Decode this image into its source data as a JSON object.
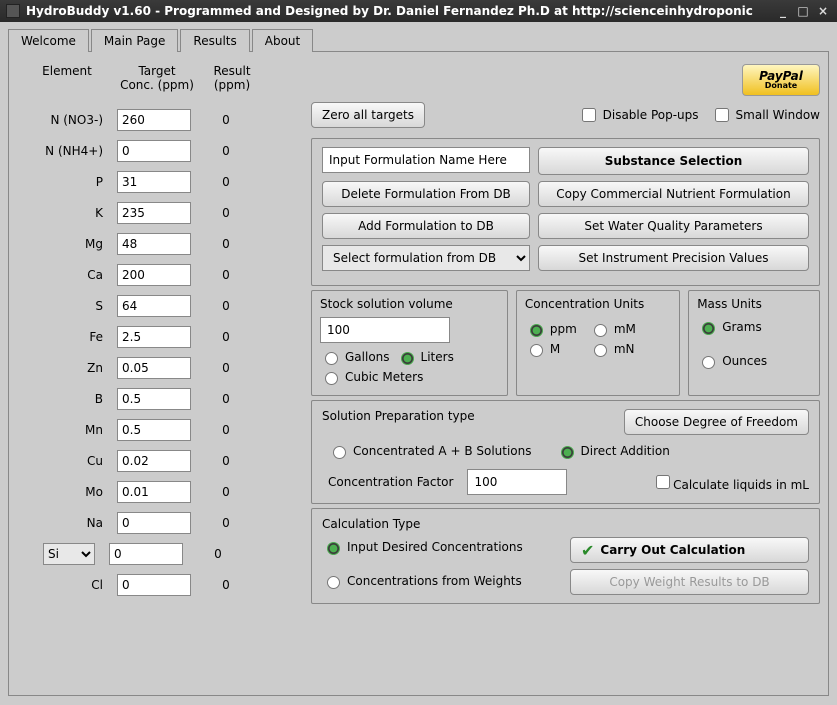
{
  "window": {
    "title": "HydroBuddy v1.60 - Programmed and Designed by Dr. Daniel Fernandez Ph.D at http://scienceinhydroponic"
  },
  "tabs": [
    "Welcome",
    "Main Page",
    "Results",
    "About"
  ],
  "activeTab": 1,
  "headers": {
    "element": "Element",
    "target1": "Target",
    "target2": "Conc. (ppm)",
    "result1": "Result",
    "result2": "(ppm)"
  },
  "elements": [
    {
      "label": "N (NO3-)",
      "target": "260",
      "result": "0"
    },
    {
      "label": "N (NH4+)",
      "target": "0",
      "result": "0"
    },
    {
      "label": "P",
      "target": "31",
      "result": "0"
    },
    {
      "label": "K",
      "target": "235",
      "result": "0"
    },
    {
      "label": "Mg",
      "target": "48",
      "result": "0"
    },
    {
      "label": "Ca",
      "target": "200",
      "result": "0"
    },
    {
      "label": "S",
      "target": "64",
      "result": "0"
    },
    {
      "label": "Fe",
      "target": "2.5",
      "result": "0"
    },
    {
      "label": "Zn",
      "target": "0.05",
      "result": "0"
    },
    {
      "label": "B",
      "target": "0.5",
      "result": "0"
    },
    {
      "label": "Mn",
      "target": "0.5",
      "result": "0"
    },
    {
      "label": "Cu",
      "target": "0.02",
      "result": "0"
    },
    {
      "label": "Mo",
      "target": "0.01",
      "result": "0"
    },
    {
      "label": "Na",
      "target": "0",
      "result": "0"
    },
    {
      "label": "Si",
      "target": "0",
      "result": "0",
      "dropdown": true
    },
    {
      "label": "Cl",
      "target": "0",
      "result": "0"
    }
  ],
  "buttons": {
    "zero": "Zero all targets",
    "formName": "Input Formulation Name Here",
    "substanceSel": "Substance Selection",
    "deleteForm": "Delete Formulation From DB",
    "copyComm": "Copy Commercial Nutrient Formulation",
    "addForm": "Add Formulation to DB",
    "waterQual": "Set Water Quality Parameters",
    "selectForm": "Select formulation from DB",
    "precision": "Set Instrument Precision Values",
    "dof": "Choose Degree of Freedom",
    "carry": "Carry Out Calculation",
    "copyWeight": "Copy Weight Results to DB",
    "donate_top": "PayPal",
    "donate_bottom": "Donate"
  },
  "checks": {
    "disablePopups": "Disable Pop-ups",
    "smallWindow": "Small Window",
    "liquidsML": "Calculate liquids in mL"
  },
  "stock": {
    "title": "Stock solution volume",
    "value": "100",
    "gallons": "Gallons",
    "liters": "Liters",
    "cubic": "Cubic Meters",
    "selected": "liters"
  },
  "conc": {
    "title": "Concentration Units",
    "ppm": "ppm",
    "mM": "mM",
    "M": "M",
    "mN": "mN",
    "selected": "ppm"
  },
  "mass": {
    "title": "Mass Units",
    "grams": "Grams",
    "ounces": "Ounces",
    "selected": "grams"
  },
  "prep": {
    "title": "Solution Preparation type",
    "ab": "Concentrated A + B Solutions",
    "direct": "Direct Addition",
    "selected": "direct",
    "factorLabel": "Concentration Factor",
    "factorValue": "100"
  },
  "calc": {
    "title": "Calculation Type",
    "input": "Input Desired Concentrations",
    "weights": "Concentrations from  Weights",
    "selected": "input"
  }
}
